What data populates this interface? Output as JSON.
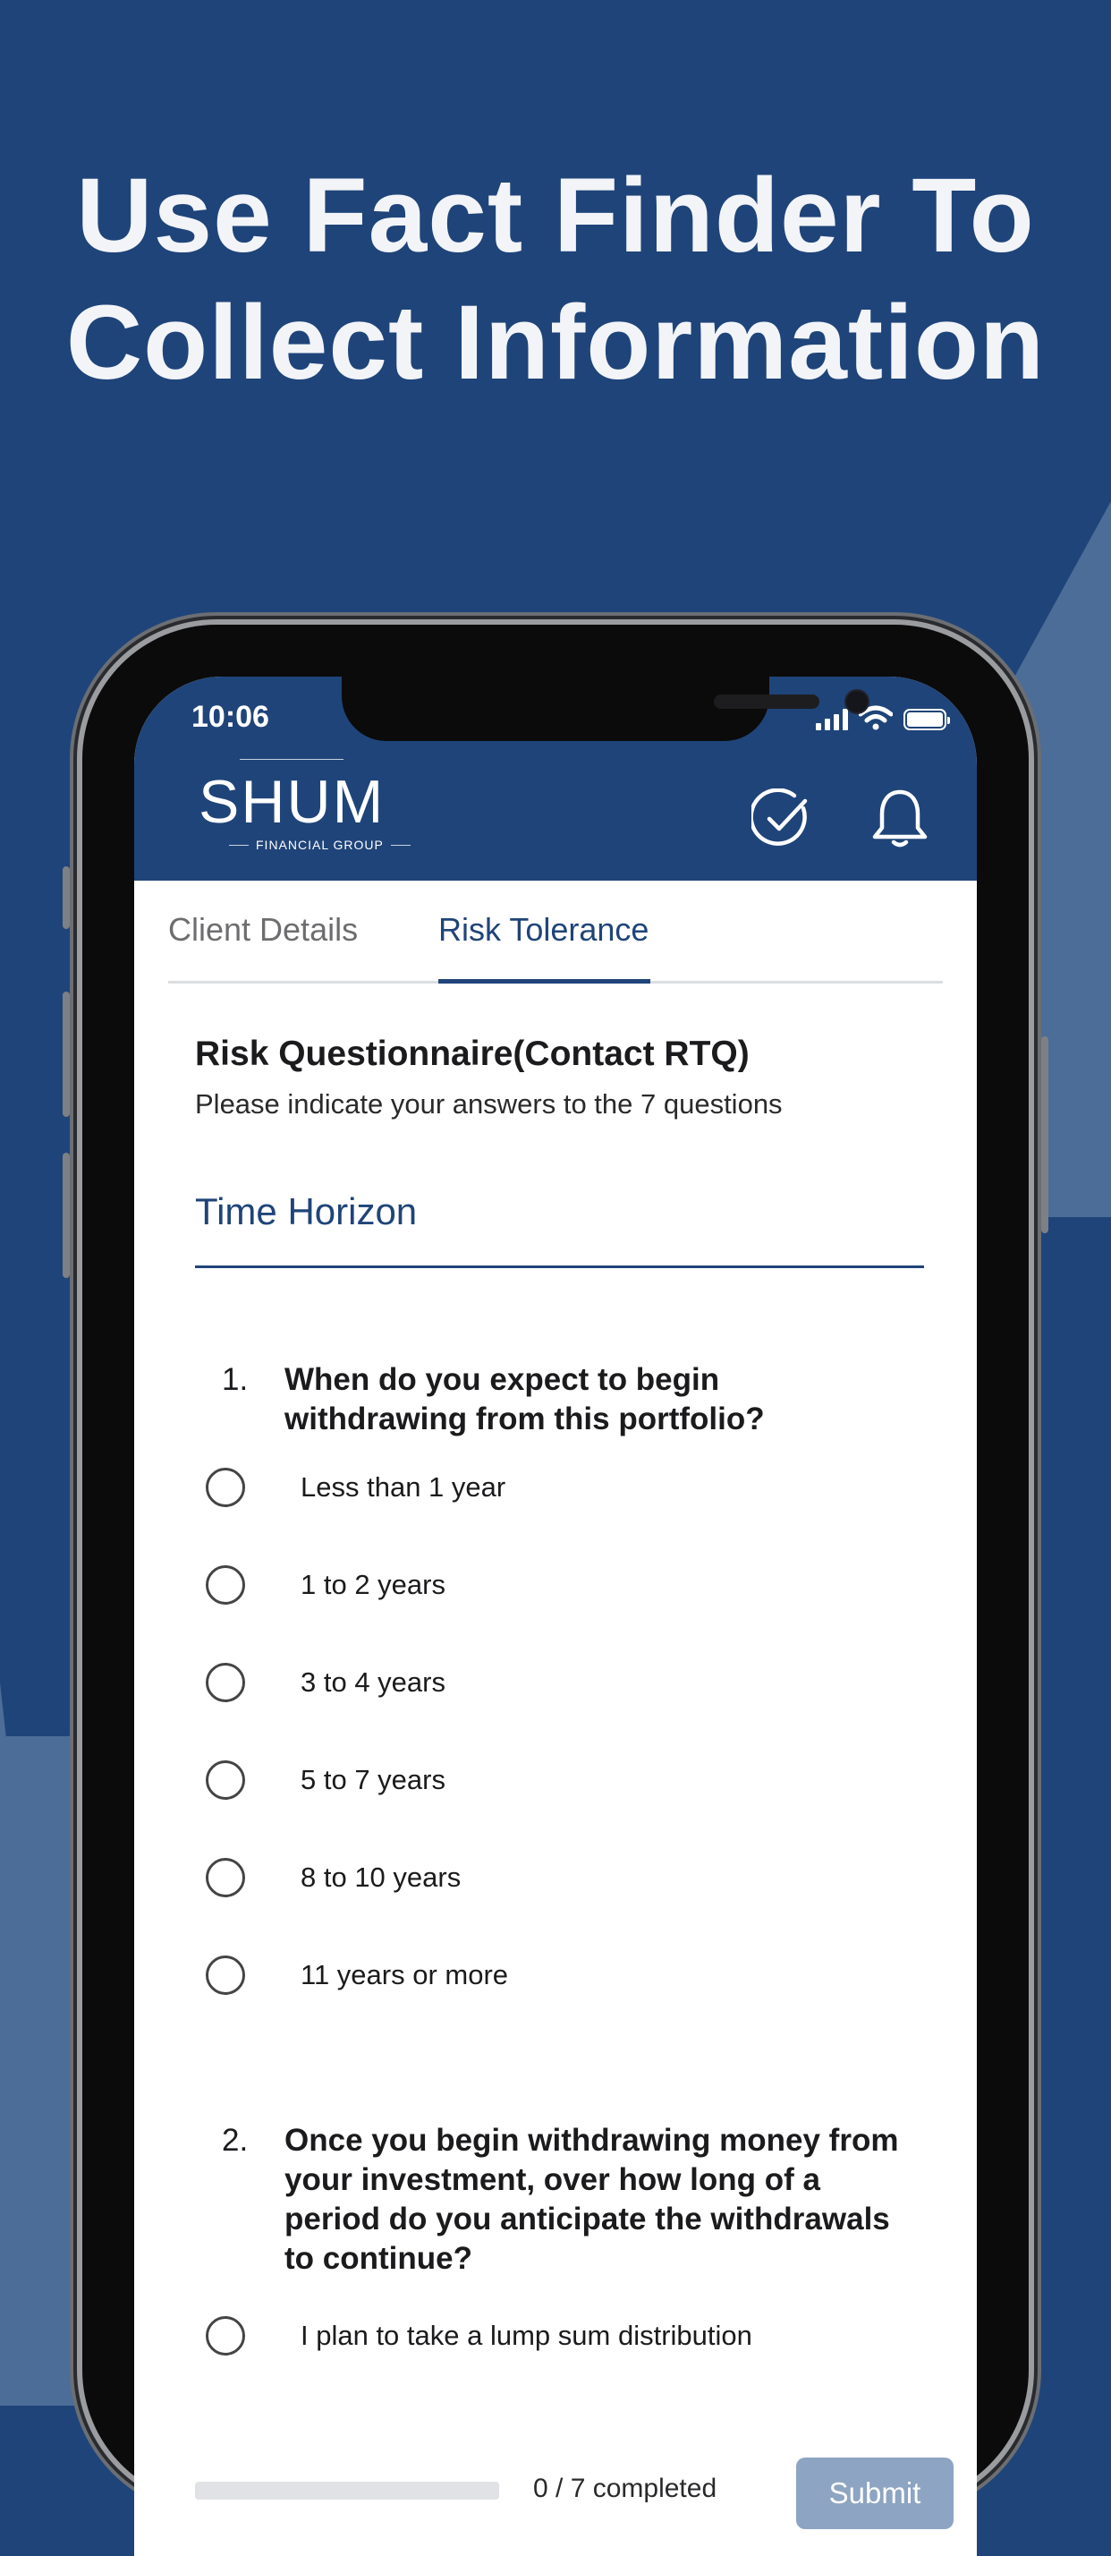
{
  "headline": {
    "line1": "Use Fact Finder To",
    "line2": "Collect Information"
  },
  "status_bar": {
    "time": "10:06"
  },
  "app_header": {
    "logo_text": "SHUM",
    "logo_subtext": "FINANCIAL GROUP",
    "icons": [
      "checkmark-circle-icon",
      "bell-icon"
    ]
  },
  "tabs": [
    {
      "label": "Client Details",
      "active": false
    },
    {
      "label": "Risk Tolerance",
      "active": true
    }
  ],
  "questionnaire": {
    "title": "Risk Questionnaire(Contact RTQ)",
    "subtitle": "Please indicate your answers to the 7 questions"
  },
  "section": {
    "title": "Time Horizon"
  },
  "questions": [
    {
      "number": "1.",
      "text": "When do you expect to begin withdrawing from this portfolio?",
      "options": [
        "Less than 1 year",
        "1 to 2 years",
        "3 to 4 years",
        "5 to 7 years",
        "8 to 10 years",
        "11 years or more"
      ]
    },
    {
      "number": "2.",
      "text": "Once you begin withdrawing money from your investment, over how long of a period do you anticipate the withdrawals to continue?",
      "options": [
        "I plan to take a lump sum distribution"
      ]
    }
  ],
  "footer": {
    "progress_text": "0 / 7 completed",
    "progress_fraction": 0,
    "submit_label": "Submit"
  },
  "colors": {
    "brand_blue": "#1f4479",
    "accent_light": "#4b6d97",
    "submit_disabled": "#8da4c2"
  }
}
